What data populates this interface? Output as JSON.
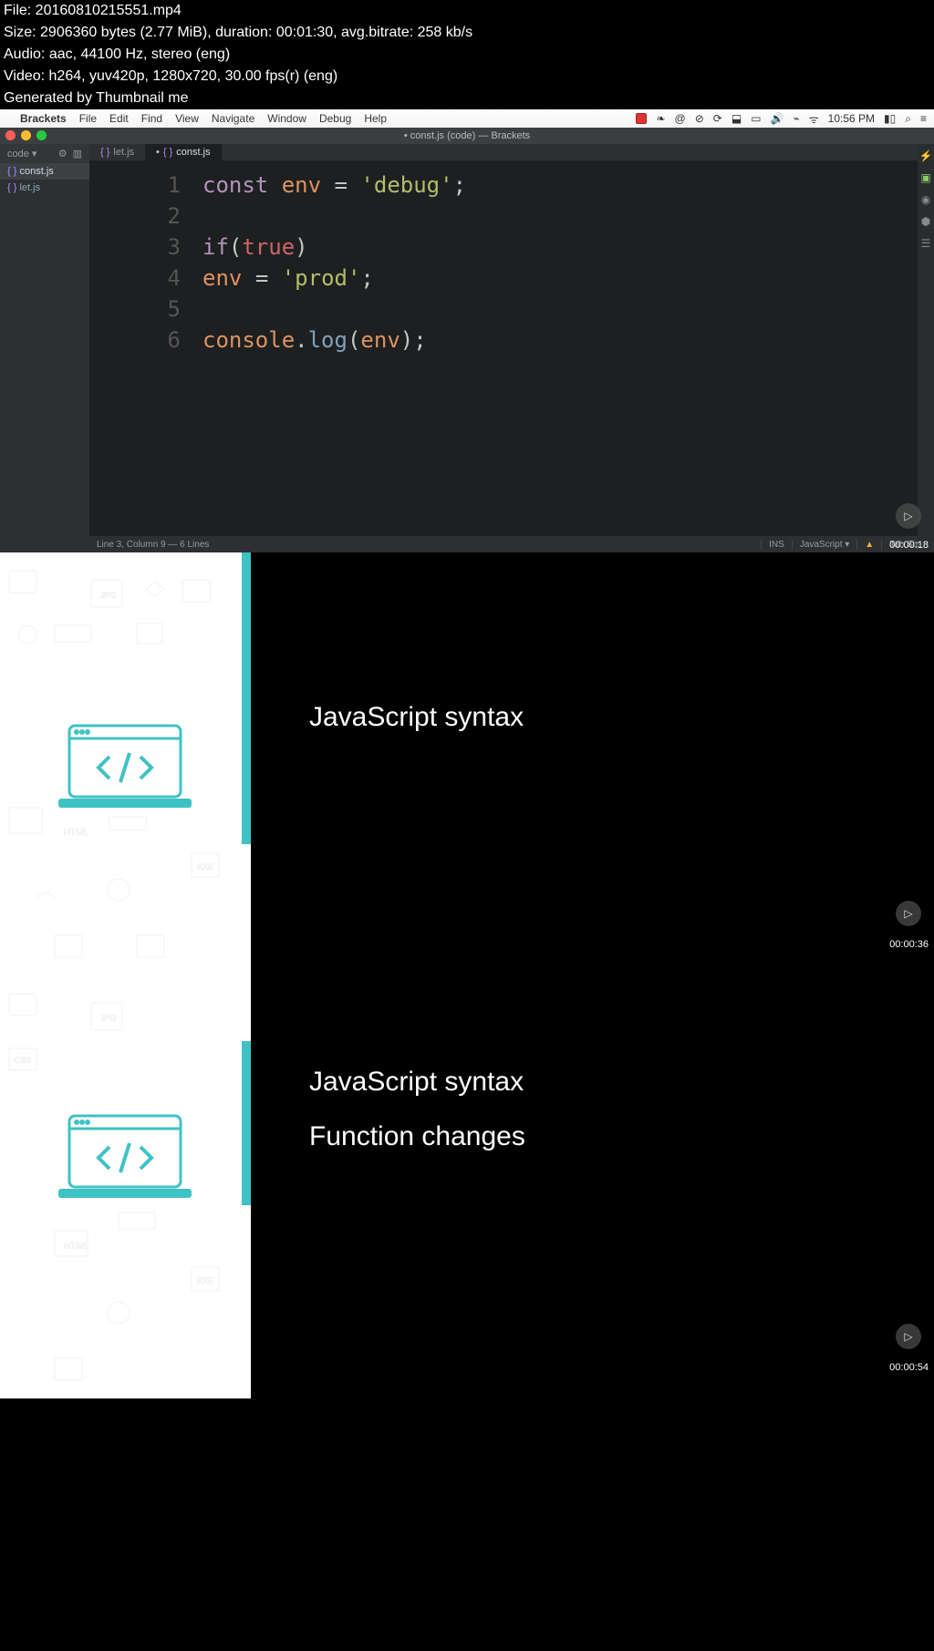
{
  "meta": {
    "file": "File: 20160810215551.mp4",
    "size": "Size: 2906360 bytes (2.77 MiB), duration: 00:01:30, avg.bitrate: 258 kb/s",
    "audio": "Audio: aac, 44100 Hz, stereo (eng)",
    "video": "Video: h264, yuv420p, 1280x720, 30.00 fps(r) (eng)",
    "gen": "Generated by Thumbnail me"
  },
  "menubar": {
    "app": "Brackets",
    "items": [
      "File",
      "Edit",
      "Find",
      "View",
      "Navigate",
      "Window",
      "Debug",
      "Help"
    ],
    "clock": "10:56 PM"
  },
  "titlebar": "• const.js (code) — Brackets",
  "sidebar": {
    "header": "code ▾",
    "files": [
      {
        "br": "{ }",
        "name": "const.js",
        "active": true
      },
      {
        "br": "{ }",
        "name": "let.js",
        "active": false
      }
    ]
  },
  "tabs": [
    {
      "br": "{ }",
      "name": "let.js",
      "active": false,
      "dirty": false
    },
    {
      "br": "{ }",
      "name": "const.js",
      "active": true,
      "dirty": true
    }
  ],
  "code": {
    "lines": [
      "1",
      "2",
      "3",
      "4",
      "5",
      "6"
    ]
  },
  "status": {
    "left": "Line 3, Column 9 — 6 Lines",
    "ins": "INS",
    "lang": "JavaScript ▾",
    "tab": "Tab Siz"
  },
  "thumbs": [
    {
      "ts": "00:00:18"
    },
    {
      "ts": "00:00:36",
      "title1": "JavaScript syntax"
    },
    {
      "ts": "00:00:54",
      "title1": "JavaScript syntax",
      "title2": "Function changes"
    }
  ]
}
